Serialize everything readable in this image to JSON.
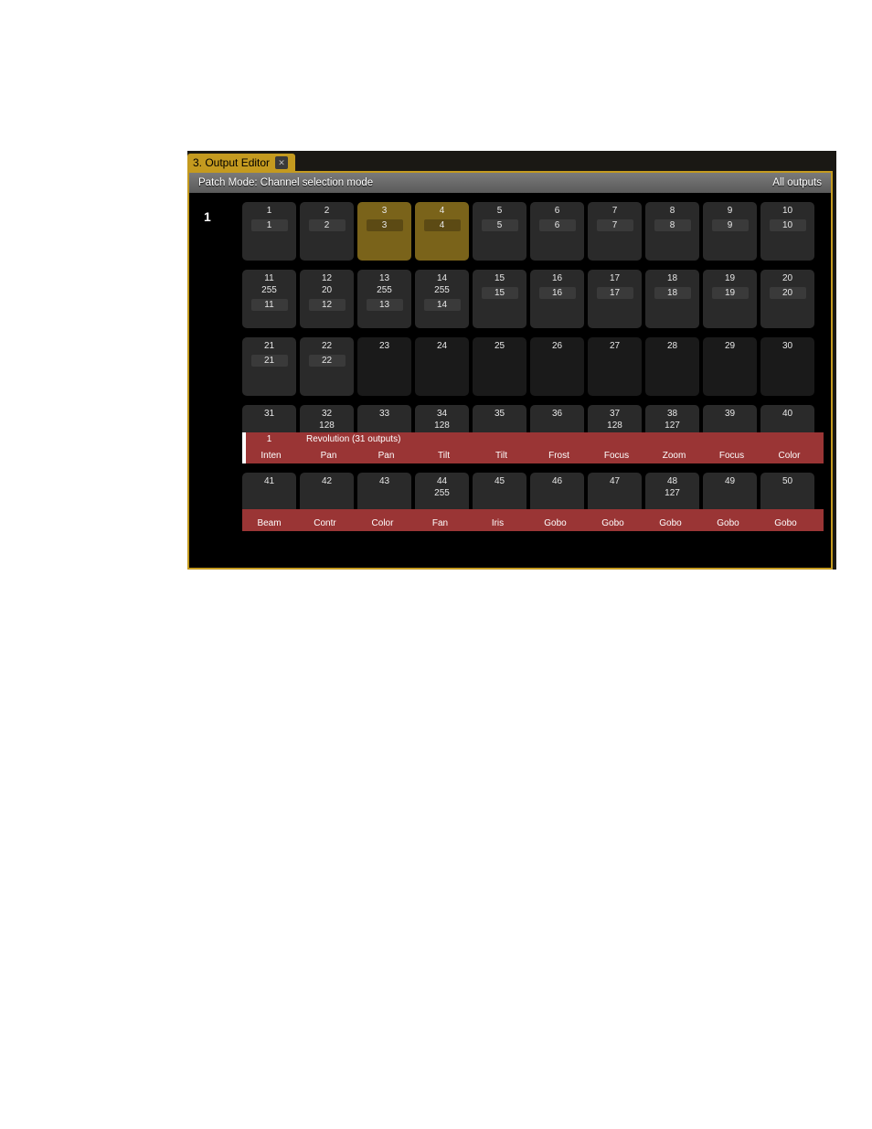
{
  "tab": {
    "title": "3. Output Editor"
  },
  "status": {
    "left": "Patch Mode: Channel selection mode",
    "right": "All outputs"
  },
  "universe": "1",
  "fixture_overlay": {
    "header_num": "1",
    "header_text": "Revolution (31 outputs)"
  },
  "rows": [
    {
      "cells": [
        {
          "top": "1",
          "mini": "1",
          "sel": false
        },
        {
          "top": "2",
          "mini": "2",
          "sel": false
        },
        {
          "top": "3",
          "mini": "3",
          "sel": true
        },
        {
          "top": "4",
          "mini": "4",
          "sel": true
        },
        {
          "top": "5",
          "mini": "5",
          "sel": false
        },
        {
          "top": "6",
          "mini": "6",
          "sel": false
        },
        {
          "top": "7",
          "mini": "7",
          "sel": false
        },
        {
          "top": "8",
          "mini": "8",
          "sel": false
        },
        {
          "top": "9",
          "mini": "9",
          "sel": false
        },
        {
          "top": "10",
          "mini": "10",
          "sel": false
        }
      ]
    },
    {
      "cells": [
        {
          "top": "11",
          "val": "255",
          "mini": "11",
          "sel": false
        },
        {
          "top": "12",
          "val": "20",
          "mini": "12",
          "sel": false
        },
        {
          "top": "13",
          "val": "255",
          "mini": "13",
          "sel": false
        },
        {
          "top": "14",
          "val": "255",
          "mini": "14",
          "sel": false
        },
        {
          "top": "15",
          "mini": "15",
          "sel": false
        },
        {
          "top": "16",
          "mini": "16",
          "sel": false
        },
        {
          "top": "17",
          "mini": "17",
          "sel": false
        },
        {
          "top": "18",
          "mini": "18",
          "sel": false
        },
        {
          "top": "19",
          "mini": "19",
          "sel": false
        },
        {
          "top": "20",
          "mini": "20",
          "sel": false
        }
      ]
    },
    {
      "cells": [
        {
          "top": "21",
          "mini": "21",
          "sel": false
        },
        {
          "top": "22",
          "mini": "22",
          "sel": false
        },
        {
          "top": "23",
          "dark": true
        },
        {
          "top": "24",
          "dark": true
        },
        {
          "top": "25",
          "dark": true
        },
        {
          "top": "26",
          "dark": true
        },
        {
          "top": "27",
          "dark": true
        },
        {
          "top": "28",
          "dark": true
        },
        {
          "top": "29",
          "dark": true
        },
        {
          "top": "30",
          "dark": true
        }
      ]
    },
    {
      "overlay": {
        "show_header": true,
        "labels": [
          "Inten",
          "Pan",
          "Pan",
          "Tilt",
          "Tilt",
          "Frost",
          "Focus",
          "Zoom",
          "Focus",
          "Color"
        ]
      },
      "cells": [
        {
          "top": "31",
          "sel": false
        },
        {
          "top": "32",
          "val": "128",
          "sel": false
        },
        {
          "top": "33",
          "sel": false
        },
        {
          "top": "34",
          "val": "128",
          "sel": false
        },
        {
          "top": "35",
          "sel": false
        },
        {
          "top": "36",
          "sel": false
        },
        {
          "top": "37",
          "val": "128",
          "sel": false
        },
        {
          "top": "38",
          "val": "127",
          "sel": false
        },
        {
          "top": "39",
          "sel": false
        },
        {
          "top": "40",
          "sel": false
        }
      ]
    },
    {
      "overlay": {
        "show_header": false,
        "labels": [
          "Beam",
          "Contr",
          "Color",
          "Fan",
          "Iris",
          "Gobo",
          "Gobo",
          "Gobo",
          "Gobo",
          "Gobo"
        ]
      },
      "cells": [
        {
          "top": "41",
          "sel": false
        },
        {
          "top": "42",
          "sel": false
        },
        {
          "top": "43",
          "sel": false
        },
        {
          "top": "44",
          "val": "255",
          "sel": false
        },
        {
          "top": "45",
          "sel": false
        },
        {
          "top": "46",
          "sel": false
        },
        {
          "top": "47",
          "sel": false
        },
        {
          "top": "48",
          "val": "127",
          "sel": false
        },
        {
          "top": "49",
          "sel": false
        },
        {
          "top": "50",
          "sel": false
        }
      ]
    }
  ]
}
